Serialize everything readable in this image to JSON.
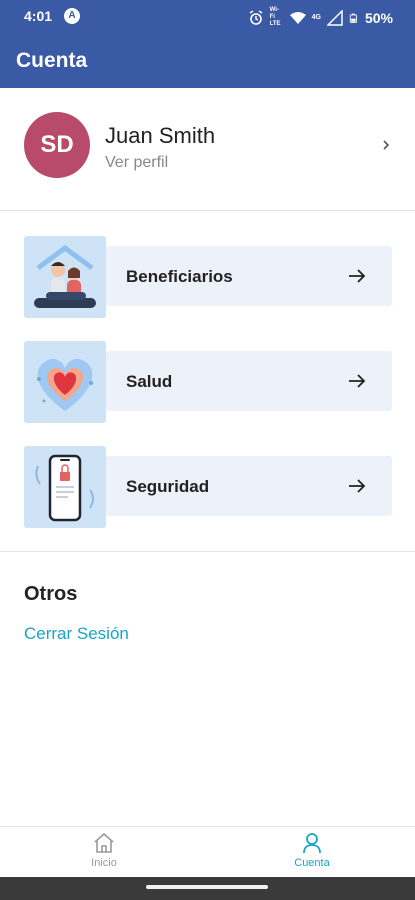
{
  "status_bar": {
    "time": "4:01",
    "indicator": "A",
    "network_text": "Wi-Fi LTE",
    "signal_text": "4G",
    "battery": "50%",
    "icons": [
      "alarm-icon",
      "wifi-icon",
      "signal-icon",
      "battery-icon"
    ]
  },
  "header": {
    "title": "Cuenta"
  },
  "profile": {
    "initials": "SD",
    "name": "Juan Smith",
    "subtitle": "Ver perfil"
  },
  "menu": [
    {
      "label": "Beneficiarios",
      "icon": "beneficiaries-illustration"
    },
    {
      "label": "Salud",
      "icon": "health-heart-illustration"
    },
    {
      "label": "Seguridad",
      "icon": "security-phone-illustration"
    }
  ],
  "others": {
    "title": "Otros",
    "logout": "Cerrar Sesión"
  },
  "bottom_nav": [
    {
      "label": "Inicio",
      "icon": "home-icon",
      "active": false
    },
    {
      "label": "Cuenta",
      "icon": "user-icon",
      "active": true
    }
  ],
  "colors": {
    "header": "#3a5aa6",
    "accent": "#19a4c8",
    "avatar": "#b84a6b",
    "card": "#edf2fa"
  }
}
